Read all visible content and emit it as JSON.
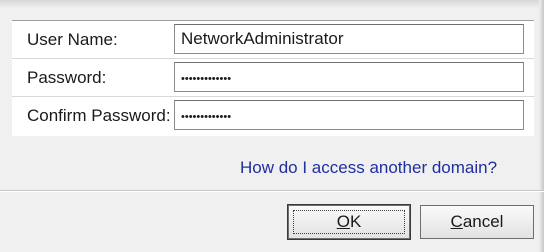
{
  "fields": {
    "username": {
      "label": "User Name:",
      "value": "NetworkAdministrator"
    },
    "password": {
      "label": "Password:",
      "value": "•••••••••••••"
    },
    "confirm": {
      "label": "Confirm Password:",
      "value": "•••••••••••••"
    }
  },
  "help_link": "How do I access another domain?",
  "buttons": {
    "ok": {
      "mnemonic": "O",
      "rest": "K"
    },
    "cancel": {
      "mnemonic": "C",
      "rest": "ancel"
    }
  }
}
